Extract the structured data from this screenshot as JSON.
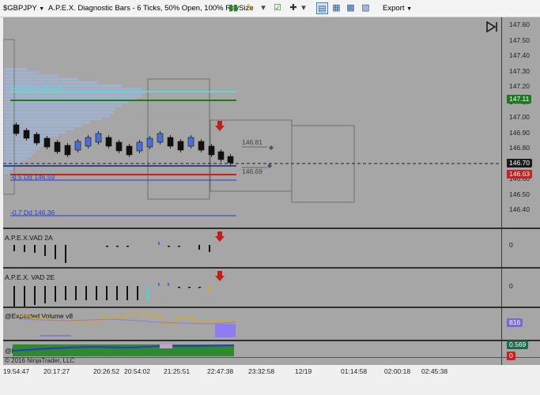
{
  "toolbar": {
    "instrument": "$GBPJPY",
    "chart_title": "A.P.E.X. Diagnostic Bars - 6 Ticks, 50% Open, 100% RevSize",
    "export_label": "Export"
  },
  "price_axis": {
    "ticks": [
      "147.60",
      "147.50",
      "147.40",
      "147.30",
      "147.20",
      "147.10",
      "147.00",
      "146.90",
      "146.80",
      "146.70",
      "146.60",
      "146.50",
      "146.40"
    ],
    "badges": [
      {
        "text": "147.11",
        "color": "#1e7a1e"
      },
      {
        "text": "146.70",
        "color": "#1a1a1a"
      },
      {
        "text": "146.63",
        "color": "#cc1f1f"
      }
    ]
  },
  "levels": {
    "upper_label": "Sell Zone 147.16",
    "lower_label_1": "-0.5 Dd 146.59",
    "lower_label_2": "-0.7 Dd 146.36",
    "box_upper": "146.81",
    "box_lower": "146.69"
  },
  "indicators": {
    "vad2a_label": "A.P.E.X.VAD 2A",
    "vad2a_zero": "0",
    "vad2e_label": "A.P.E.X. VAD 2E",
    "vad2e_zero": "0",
    "volume_label": "@Expected Volume v8",
    "volume_value": "816",
    "deviation_label": "@Deviation",
    "deviation_value": "0.569",
    "deviation_zero": "0"
  },
  "time_axis": {
    "labels": [
      "19:54:47",
      "20:17:27",
      "20:26:52",
      "20:54:02",
      "21:25:51",
      "22:47:38",
      "23:32:58",
      "12/19",
      "01:14:58",
      "02:00:18",
      "02:45:38"
    ]
  },
  "copyright": "© 2016 NinjaTrader, LLC",
  "colors": {
    "background": "#a6a6a6",
    "up_bar": "#4a6fd8",
    "down_bar": "#111111",
    "sell_zone": "#55e0e0",
    "green_line": "#1e7a1e",
    "red_line": "#cc1f1f",
    "blue_line": "#2a3ad0"
  }
}
